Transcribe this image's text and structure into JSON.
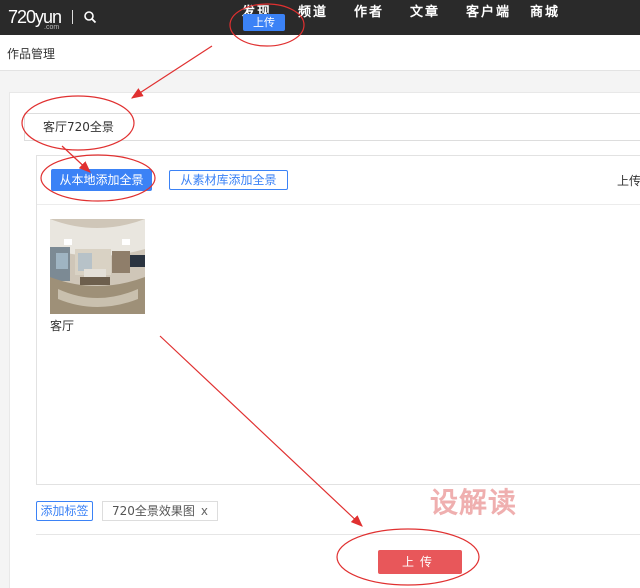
{
  "nav": {
    "logo": "720yun",
    "logo_sub": ".com",
    "items": [
      "发现",
      "频道",
      "作者",
      "文章",
      "客户端",
      "商城"
    ],
    "upload_label": "上传"
  },
  "subheader": {
    "title": "作品管理"
  },
  "form": {
    "name_value": "客厅720全景",
    "add_local_label": "从本地添加全景",
    "add_library_label": "从素材库添加全景",
    "right_label": "上传",
    "thumb_caption": "客厅",
    "add_tag_label": "添加标签",
    "tag": "720全景效果图",
    "tag_remove": "x",
    "upload_button": "上传"
  },
  "watermark": "设解读",
  "colors": {
    "accent_blue": "#3b82f6",
    "upload_red": "#e8575a",
    "annotation_red": "#e03030",
    "nav_bg": "#2a2a2a"
  },
  "icons": [
    "search-icon",
    "close-icon"
  ]
}
